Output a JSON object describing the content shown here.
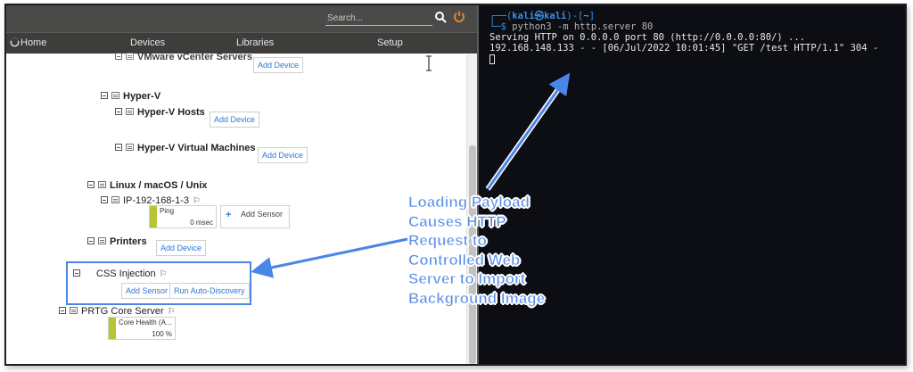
{
  "prtg": {
    "search_placeholder": "Search...",
    "nav": {
      "home": "Home",
      "devices": "Devices",
      "libraries": "Libraries",
      "setup": "Setup"
    },
    "tree": {
      "vmware_vcenter": "VMware vCenter Servers",
      "hyperv": "Hyper-V",
      "hyperv_hosts": "Hyper-V Hosts",
      "hyperv_vms": "Hyper-V Virtual Machines",
      "linux": "Linux / macOS / Unix",
      "ip_device": "IP-192-168-1-3",
      "printers": "Printers",
      "css_injection": "CSS Injection",
      "prtg_core": "PRTG Core Server"
    },
    "buttons": {
      "add_device": "Add Device",
      "add_sensor": "Add Sensor",
      "run_auto_discovery": "Run Auto-Discovery"
    },
    "sensors": {
      "ping_name": "Ping",
      "ping_value": "0 msec",
      "core_health_name": "Core Health (A...",
      "core_health_value": "100 %"
    },
    "add_sensor_box_label": "Add Sensor",
    "colors": {
      "sensor_ok": "#b6c436",
      "link": "#2a7bd6",
      "highlight": "#4a86e8"
    }
  },
  "terminal": {
    "prompt_user": "kali",
    "prompt_at": "㉿",
    "prompt_host": "kali",
    "prompt_dir": "~",
    "command": "python3",
    "command_args": " -m http.server 80",
    "line1": "Serving HTTP on 0.0.0.0 port 80 (http://0.0.0.0:80/) ...",
    "line2": "192.168.148.133 - - [06/Jul/2022 10:01:45] \"GET /test HTTP/1.1\" 304 -"
  },
  "annotation": {
    "lines": [
      "Loading Payload",
      "Causes HTTP",
      "Request to",
      "Controlled Web",
      "Server to Import",
      "Background Image"
    ],
    "color": "#5b8fe8"
  }
}
